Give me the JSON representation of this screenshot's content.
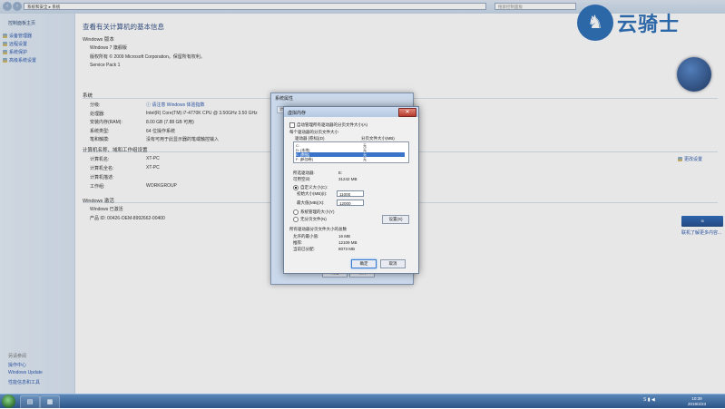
{
  "window": {
    "breadcrumb": [
      "系统和安全",
      "系统"
    ],
    "search_placeholder": "搜索控制面板"
  },
  "sidebar": {
    "home": "控制面板主页",
    "links": [
      "设备管理器",
      "远程设置",
      "系统保护",
      "高级系统设置"
    ],
    "see_also": "另请参阅",
    "footer_links": [
      "操作中心",
      "Windows Update",
      "性能信息和工具"
    ]
  },
  "main": {
    "heading": "查看有关计算机的基本信息",
    "edition": {
      "title": "Windows 版本",
      "name": "Windows 7 旗舰版",
      "copyright": "版权所有 © 2009 Microsoft Corporation。保留所有权利。",
      "service_pack": "Service Pack 1"
    },
    "system": {
      "title": "系统",
      "rows": [
        {
          "label": "分级:",
          "value": "请注意 Windows 体验指数"
        },
        {
          "label": "处理器:",
          "value": "Intel(R) Core(TM) i7-4770K CPU @ 3.50GHz   3.50 GHz"
        },
        {
          "label": "安装内存(RAM):",
          "value": "8.00 GB (7.88 GB 可用)"
        },
        {
          "label": "系统类型:",
          "value": "64 位操作系统"
        },
        {
          "label": "笔和触摸:",
          "value": "没有可用于此显示器的笔或触控输入"
        }
      ]
    },
    "computer": {
      "title": "计算机名称、域和工作组设置",
      "rows": [
        {
          "label": "计算机名:",
          "value": "XT-PC"
        },
        {
          "label": "计算机全名:",
          "value": "XT-PC"
        },
        {
          "label": "计算机描述:",
          "value": ""
        },
        {
          "label": "工作组:",
          "value": "WORKGROUP"
        }
      ],
      "change_settings": "更改设置"
    },
    "activation": {
      "title": "Windows 激活",
      "status": "Windows 已激活",
      "product_id": "产品 ID: 00426-OEM-8992662-00400",
      "more_link": "联机了解更多内容..."
    }
  },
  "watermark": {
    "text": "云骑士"
  },
  "dialog_outer": {
    "title": "系统属性",
    "tabs": [
      "计算机名",
      "硬件",
      "高级",
      "系统保护",
      "远程"
    ],
    "ok": "确定",
    "cancel": "取消"
  },
  "dialog": {
    "title": "虚拟内存",
    "auto_manage": "自动管理所有驱动器的分页文件大小(A)",
    "per_drive_header": "每个驱动器的分页文件大小",
    "col_drive": "驱动器 [卷标](D)",
    "col_size": "分页文件大小(MB)",
    "drives": [
      {
        "drive": "C:",
        "label": "",
        "size": "无"
      },
      {
        "drive": "D:",
        "label": "[本地]",
        "size": "无"
      },
      {
        "drive": "E:",
        "label": "[数据]",
        "size": "无"
      },
      {
        "drive": "F:",
        "label": "[新加卷]",
        "size": "无"
      }
    ],
    "selected_drive_label": "所选驱动器:",
    "selected_drive": "E:",
    "available_label": "可用空间:",
    "available": "31242 MB",
    "custom_size": "自定义大小(C):",
    "initial_label": "初始大小(MB)(I):",
    "initial_value": "11000",
    "max_label": "最大值(MB)(X):",
    "max_value": "12000",
    "system_managed": "系统管理的大小(Y)",
    "no_paging": "无分页文件(N)",
    "set_button": "设置(S)",
    "total_header": "所有驱动器分页文件大小的总数",
    "min_label": "允许的最小值:",
    "min_value": "16 MB",
    "recommended_label": "推荐:",
    "recommended_value": "12109 MB",
    "current_label": "当前已分配:",
    "current_value": "8073 MB",
    "ok": "确定",
    "cancel": "取消"
  },
  "taskbar": {
    "time": "10:39",
    "date": "2019/4/23"
  }
}
